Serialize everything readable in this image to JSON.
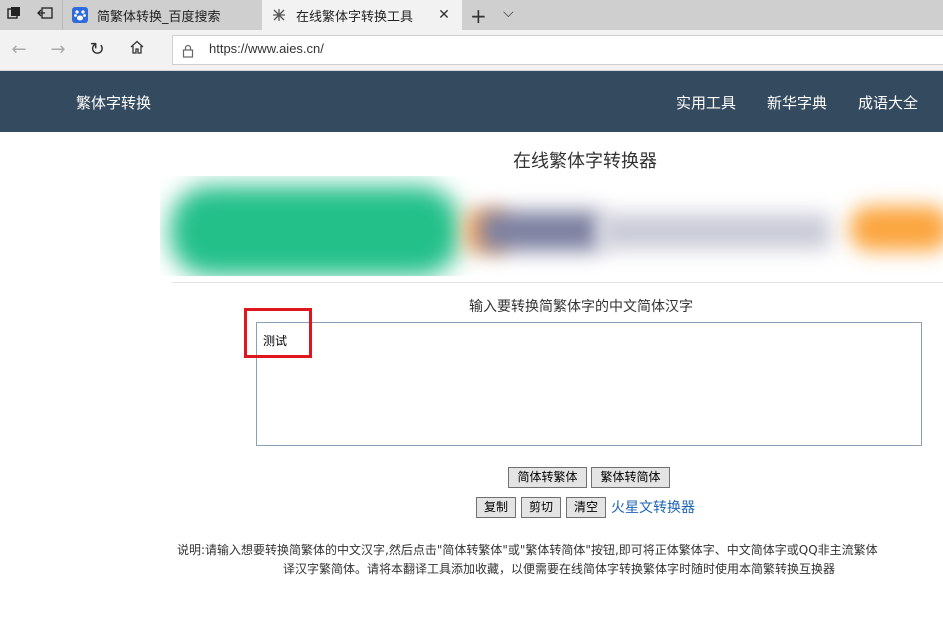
{
  "browser": {
    "tabs": [
      {
        "title": "简繁体转换_百度搜索",
        "icon": "baidu-paw-icon",
        "active": false
      },
      {
        "title": "在线繁体字转换工具",
        "icon": "site-favicon-icon",
        "active": true
      }
    ],
    "url": "https://www.aies.cn/"
  },
  "site": {
    "brand": "繁体字转换",
    "nav": [
      "实用工具",
      "新华字典",
      "成语大全"
    ]
  },
  "main": {
    "title": "在线繁体字转换器",
    "prompt": "输入要转换简繁体字的中文简体汉字",
    "input_value": "测试",
    "buttons": {
      "to_traditional": "简体转繁体",
      "to_simplified": "繁体转简体",
      "copy": "复制",
      "cut": "剪切",
      "clear": "清空"
    },
    "martian_link": "火星文转换器",
    "description_line1": "说明:请输入想要转换简繁体的中文汉字,然后点击\"简体转繁体\"或\"繁体转简体\"按钮,即可将正体繁体字、中文简体字或QQ非主流繁体",
    "description_line2": "译汉字繁简体。请将本翻译工具添加收藏，以便需要在线简体字转换繁体字时随时使用本简繁转换互换器"
  },
  "colors": {
    "header_bg": "#344a5e",
    "link": "#1f64b4",
    "highlight": "#e0161f"
  }
}
